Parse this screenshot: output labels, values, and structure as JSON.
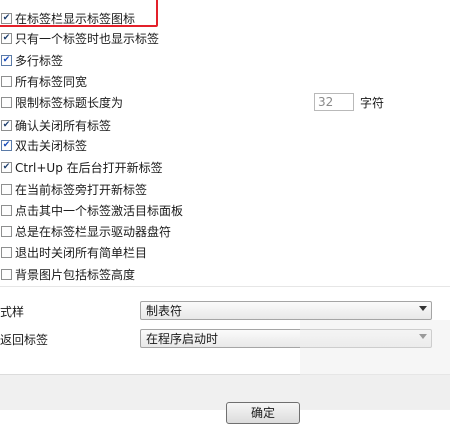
{
  "options": [
    {
      "label": "在标签栏显示标签图标",
      "checked": true
    },
    {
      "label": "只有一个标签时也显示标签",
      "checked": true
    },
    {
      "label": "多行标签",
      "checked": true,
      "blue": true
    },
    {
      "label": "所有标签同宽",
      "checked": false
    },
    {
      "label": "限制标签标题长度为",
      "checked": false
    },
    {
      "label": "确认关闭所有标签",
      "checked": true
    },
    {
      "label": "双击关闭标签",
      "checked": true,
      "blue": true
    },
    {
      "label": "Ctrl+Up 在后台打开新标签",
      "checked": true
    },
    {
      "label": "在当前标签旁打开新标签",
      "checked": false
    },
    {
      "label": "点击其中一个标签激活目标面板",
      "checked": false
    },
    {
      "label": "总是在标签栏显示驱动器盘符",
      "checked": false
    },
    {
      "label": "退出时关闭所有简单栏目",
      "checked": false
    },
    {
      "label": "背景图片包括标签高度",
      "checked": false
    }
  ],
  "title_length": {
    "value": "32",
    "unit": "字符"
  },
  "style_field": {
    "label": "式样",
    "selected": "制表符"
  },
  "return_tab_field": {
    "label": "返回标签",
    "selected": "在程序启动时"
  },
  "ok_button": {
    "label": "确定"
  }
}
